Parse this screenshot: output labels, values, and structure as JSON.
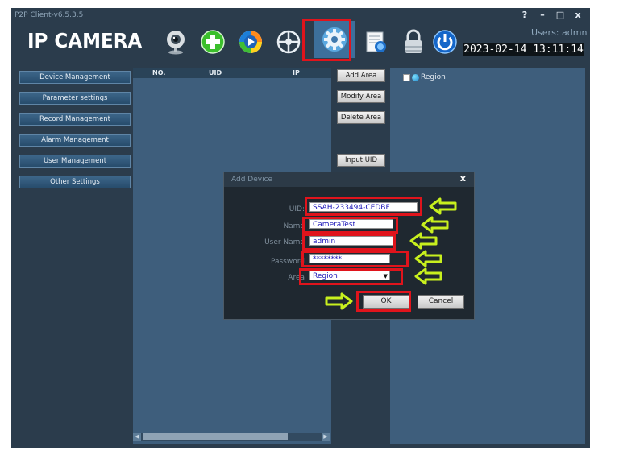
{
  "window": {
    "title": "P2P Client-v6.5.3.5",
    "controls": [
      "?",
      "–",
      "□",
      "x"
    ]
  },
  "header": {
    "logo": "IP CAMERA",
    "users": "Users: admn",
    "datetime": "2023-02-14 13:11:14",
    "toolbar_icons": [
      "webcam-icon",
      "add-icon",
      "playback-icon",
      "ptz-wheel-icon",
      "settings-gear-icon",
      "log-document-icon",
      "lock-icon",
      "power-icon"
    ]
  },
  "sidebar": {
    "items": [
      {
        "label": "Device Management"
      },
      {
        "label": "Parameter settings"
      },
      {
        "label": "Record Management"
      },
      {
        "label": "Alarm Management"
      },
      {
        "label": "User Management"
      },
      {
        "label": "Other Settings"
      }
    ]
  },
  "device_list": {
    "columns": [
      "NO.",
      "UID",
      "IP"
    ]
  },
  "actions": {
    "add_area": "Add Area",
    "modify_area": "Modify Area",
    "delete_area": "Delete Area",
    "input_uid": "Input UID"
  },
  "region_tree": {
    "root": "Region"
  },
  "dialog": {
    "title": "Add Device",
    "close": "x",
    "uid_label": "UID:",
    "uid_value": "SSAH-233494-CEDBF",
    "name_label": "Name",
    "name_value": "CameraTest",
    "username_label": "User Name",
    "username_value": "admin",
    "password_label": "Password",
    "password_value": "********|",
    "area_label": "Area",
    "area_value": "Region",
    "ok_label": "OK",
    "cancel_label": "Cancel"
  },
  "colors": {
    "highlight": "#e0141c",
    "arrow": "#c8f01e",
    "window_bg": "#2b3c4c",
    "panel_bg": "#3e5e7c"
  }
}
